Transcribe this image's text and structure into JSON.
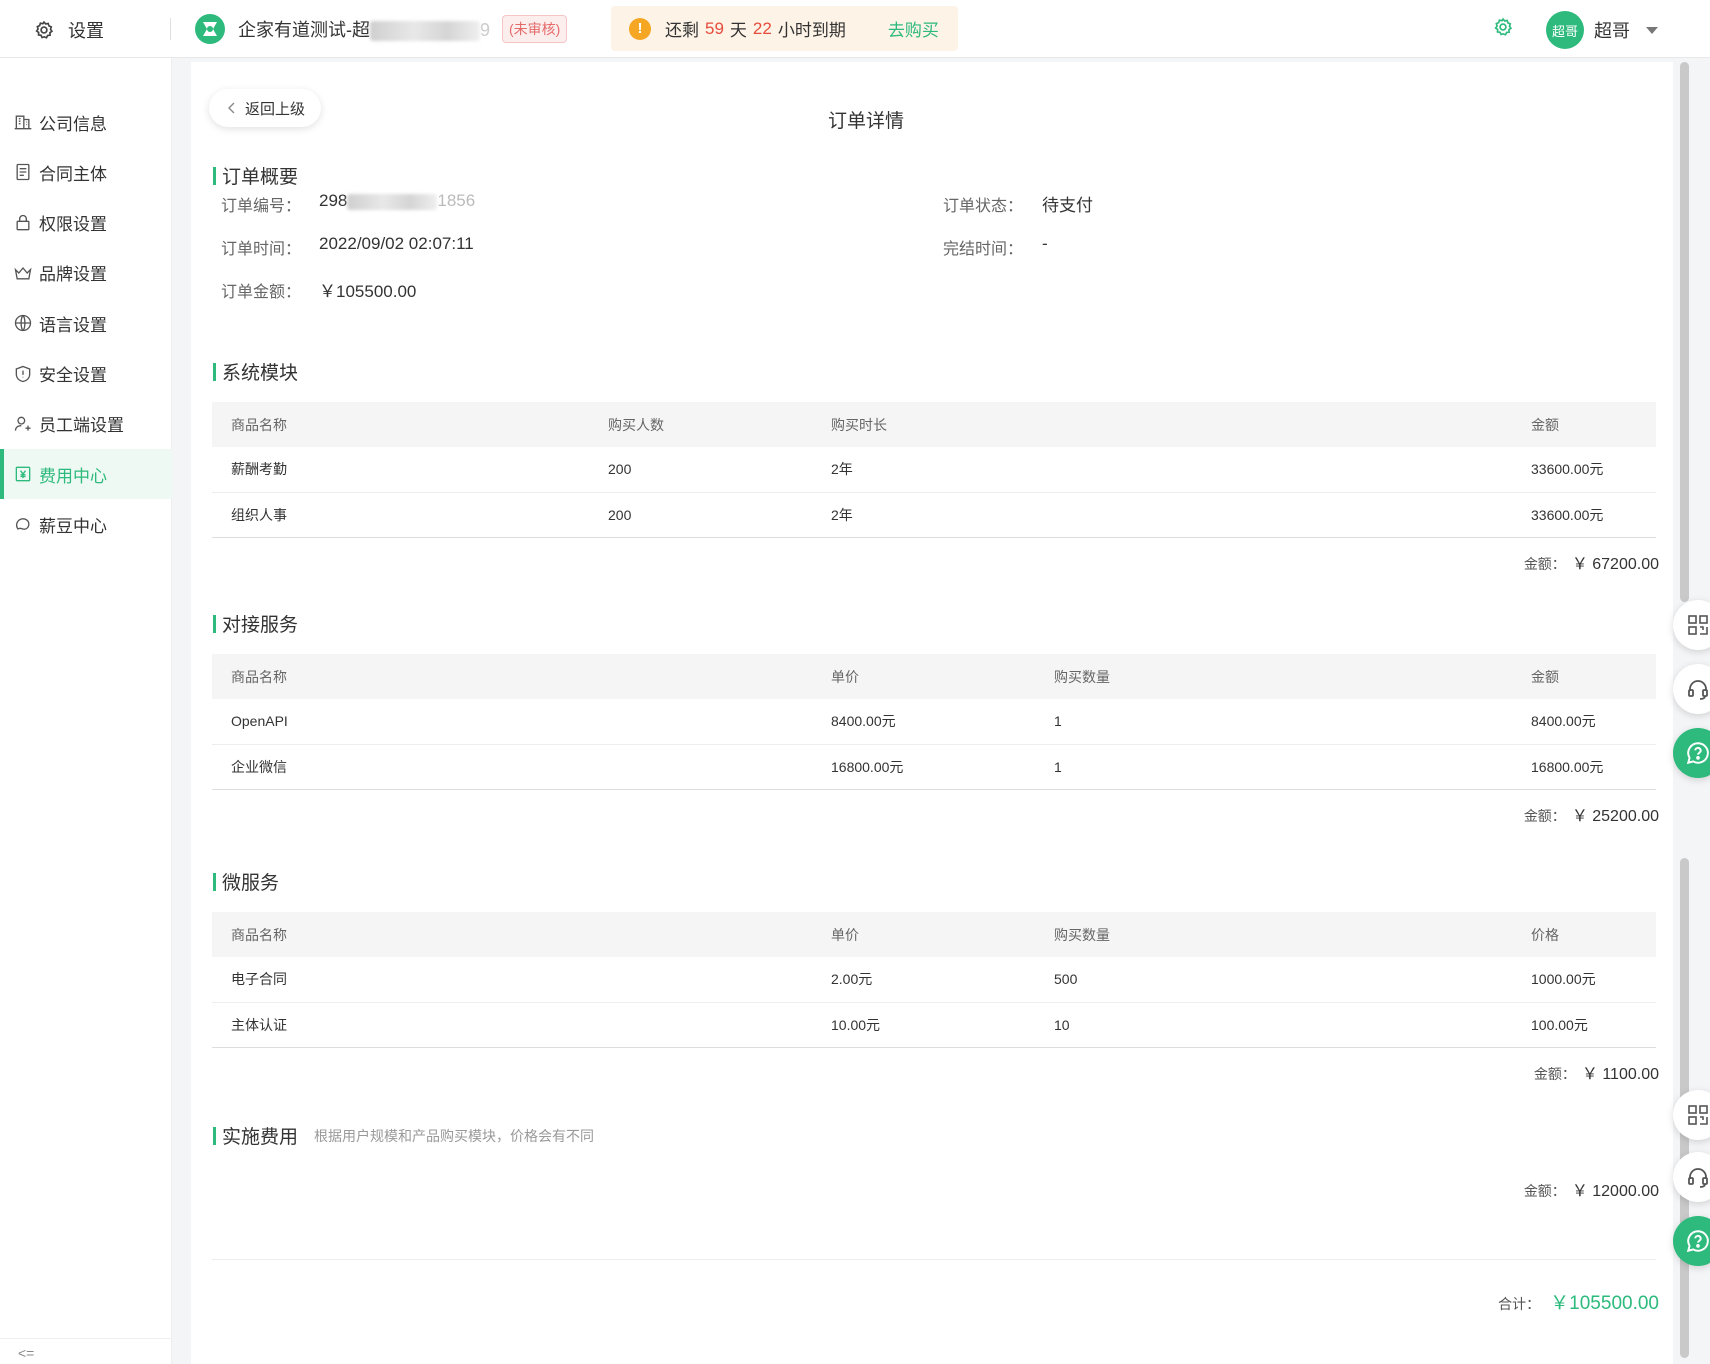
{
  "header": {
    "settings_label": "设置",
    "company_name": "企家有道测试-超",
    "company_suffix": "9",
    "unreviewed_badge": "(未审核)",
    "expire_prefix": "还剩",
    "expire_days": "59",
    "expire_day_unit": "天",
    "expire_hours": "22",
    "expire_suffix": "小时到期",
    "buy_label": "去购买",
    "user_avatar_text": "超哥",
    "user_name": "超哥"
  },
  "sidebar": {
    "items": [
      {
        "label": "公司信息",
        "icon": "building-icon"
      },
      {
        "label": "合同主体",
        "icon": "document-icon"
      },
      {
        "label": "权限设置",
        "icon": "lock-icon"
      },
      {
        "label": "品牌设置",
        "icon": "crown-icon"
      },
      {
        "label": "语言设置",
        "icon": "globe-icon"
      },
      {
        "label": "安全设置",
        "icon": "shield-icon"
      },
      {
        "label": "员工端设置",
        "icon": "user-icon"
      },
      {
        "label": "费用中心",
        "icon": "yen-icon",
        "active": true
      },
      {
        "label": "薪豆中心",
        "icon": "bean-icon"
      }
    ],
    "collapse_label": "<="
  },
  "main": {
    "back_label": "返回上级",
    "page_title": "订单详情",
    "overview": {
      "title": "订单概要",
      "order_no_label": "订单编号：",
      "order_no_value": "298",
      "order_no_tail": "1856",
      "status_label": "订单状态：",
      "status_value": "待支付",
      "time_label": "订单时间：",
      "time_value": "2022/09/02 02:07:11",
      "finish_label": "完结时间：",
      "finish_value": "-",
      "amount_label": "订单金额：",
      "amount_value": "￥105500.00"
    },
    "system_modules": {
      "title": "系统模块",
      "headers": [
        "商品名称",
        "购买人数",
        "购买时长",
        "金额"
      ],
      "rows": [
        [
          "薪酬考勤",
          "200",
          "2年",
          "33600.00元"
        ],
        [
          "组织人事",
          "200",
          "2年",
          "33600.00元"
        ]
      ],
      "subtotal_label": "金额：",
      "subtotal_value": "￥ 67200.00"
    },
    "services": {
      "title": "对接服务",
      "headers": [
        "商品名称",
        "单价",
        "购买数量",
        "金额"
      ],
      "rows": [
        [
          "OpenAPI",
          "8400.00元",
          "1",
          "8400.00元"
        ],
        [
          "企业微信",
          "16800.00元",
          "1",
          "16800.00元"
        ]
      ],
      "subtotal_label": "金额：",
      "subtotal_value": "￥ 25200.00"
    },
    "micro_services": {
      "title": "微服务",
      "headers": [
        "商品名称",
        "单价",
        "购买数量",
        "价格"
      ],
      "rows": [
        [
          "电子合同",
          "2.00元",
          "500",
          "1000.00元"
        ],
        [
          "主体认证",
          "10.00元",
          "10",
          "100.00元"
        ]
      ],
      "subtotal_label": "金额：",
      "subtotal_value": "￥ 1100.00"
    },
    "implementation": {
      "title": "实施费用",
      "note": "根据用户规模和产品购买模块，价格会有不同",
      "subtotal_label": "金额：",
      "subtotal_value": "￥ 12000.00"
    },
    "total_label": "合计：",
    "total_value": "￥105500.00"
  },
  "colors": {
    "accent": "#2dba7c",
    "warning": "#f5a623",
    "danger": "#e74c3c"
  }
}
